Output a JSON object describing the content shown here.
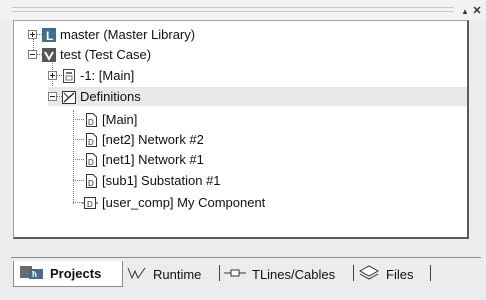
{
  "tree": {
    "items": [
      {
        "label": "master (Master Library)",
        "icon": "library-icon",
        "expander": "plus"
      },
      {
        "label": "test (Test Case)",
        "icon": "test-case-icon",
        "expander": "minus"
      },
      {
        "label": "-1: [Main]",
        "icon": "page-icon",
        "expander": "plus"
      },
      {
        "label": "Definitions",
        "icon": "definitions-icon",
        "expander": "minus"
      },
      {
        "label": "[Main]",
        "icon": "definition-icon"
      },
      {
        "label": "[net2] Network #2",
        "icon": "definition-icon"
      },
      {
        "label": "[net1] Network #1",
        "icon": "definition-icon"
      },
      {
        "label": "[sub1] Substation #1",
        "icon": "definition-icon"
      },
      {
        "label": "[user_comp] My Component",
        "icon": "component-icon"
      }
    ]
  },
  "tabs": [
    {
      "label": "Projects",
      "icon": "projects-icon",
      "active": true
    },
    {
      "label": "Runtime",
      "icon": "runtime-icon",
      "active": false
    },
    {
      "label": "TLines/Cables",
      "icon": "tlines-icon",
      "active": false
    },
    {
      "label": "Files",
      "icon": "files-icon",
      "active": false
    }
  ],
  "colors": {
    "selected_row": "#e9e9e9",
    "library_icon": "#3f6f8f",
    "test_icon": "#555555"
  }
}
